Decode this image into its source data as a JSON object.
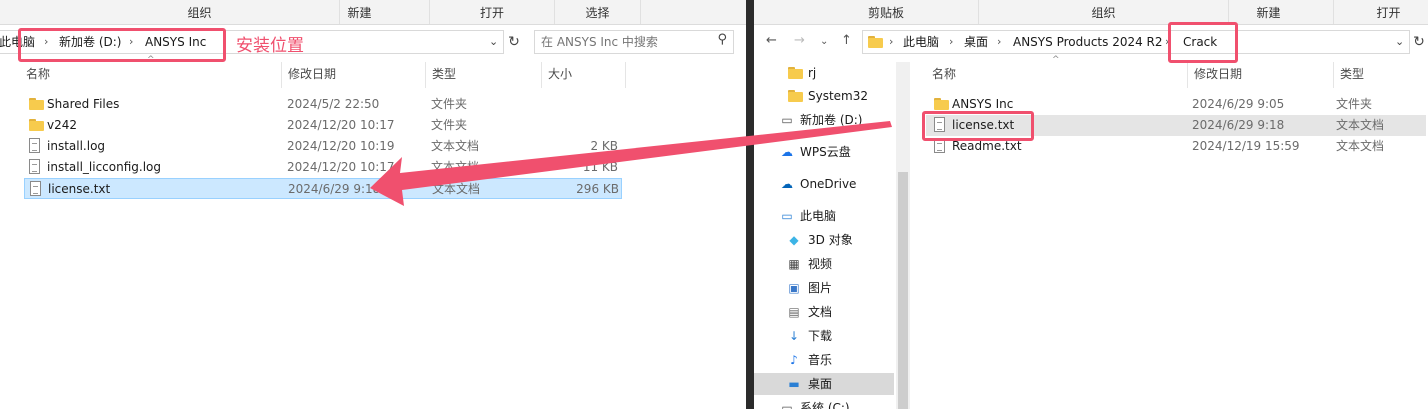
{
  "left": {
    "ribbon": [
      "组织",
      "新建",
      "打开",
      "选择"
    ],
    "breadcrumb": [
      "此电脑",
      "新加卷 (D:)",
      "ANSYS Inc"
    ],
    "search_placeholder": "在 ANSYS Inc 中搜索",
    "columns": [
      "名称",
      "修改日期",
      "类型",
      "大小"
    ],
    "files": [
      {
        "name": "Shared Files",
        "date": "2024/5/2 22:50",
        "type": "文件夹",
        "size": "",
        "icon": "folder-icon"
      },
      {
        "name": "v242",
        "date": "2024/12/20 10:17",
        "type": "文件夹",
        "size": "",
        "icon": "folder-icon"
      },
      {
        "name": "install.log",
        "date": "2024/12/20 10:19",
        "type": "文本文档",
        "size": "2 KB",
        "icon": "text-file-icon"
      },
      {
        "name": "install_licconfig.log",
        "date": "2024/12/20 10:17",
        "type": "文本文档",
        "size": "11 KB",
        "icon": "text-file-icon"
      },
      {
        "name": "license.txt",
        "date": "2024/6/29 9:18",
        "type": "文本文档",
        "size": "296 KB",
        "icon": "text-file-icon",
        "selected": true
      }
    ]
  },
  "annotation": {
    "install_location": "安装位置",
    "color": "#f0506e"
  },
  "right": {
    "ribbon": [
      "剪贴板",
      "组织",
      "新建",
      "打开"
    ],
    "breadcrumb": [
      "此电脑",
      "桌面",
      "ANSYS Products 2024 R2",
      "Crack"
    ],
    "columns": [
      "名称",
      "修改日期",
      "类型"
    ],
    "files": [
      {
        "name": "ANSYS Inc",
        "date": "2024/6/29 9:05",
        "type": "文件夹",
        "icon": "folder-icon"
      },
      {
        "name": "license.txt",
        "date": "2024/6/29 9:18",
        "type": "文本文档",
        "icon": "text-file-icon",
        "hover": true
      },
      {
        "name": "Readme.txt",
        "date": "2024/12/19 15:59",
        "type": "文本文档",
        "icon": "text-file-icon"
      }
    ],
    "tree": [
      {
        "label": "rj",
        "icon": "folder-icon"
      },
      {
        "label": "System32",
        "icon": "folder-icon"
      },
      {
        "label": "新加卷 (D:)",
        "icon": "drive-icon"
      },
      {
        "label": "WPS云盘",
        "icon": "cloud-icon"
      },
      {
        "label": "OneDrive",
        "icon": "onedrive-icon"
      },
      {
        "label": "此电脑",
        "icon": "computer-icon"
      },
      {
        "label": "3D 对象",
        "icon": "cube-icon"
      },
      {
        "label": "视频",
        "icon": "video-icon"
      },
      {
        "label": "图片",
        "icon": "picture-icon"
      },
      {
        "label": "文档",
        "icon": "document-icon"
      },
      {
        "label": "下载",
        "icon": "download-icon"
      },
      {
        "label": "音乐",
        "icon": "music-icon"
      },
      {
        "label": "桌面",
        "icon": "desktop-icon",
        "selected": true
      },
      {
        "label": "系统 (C:)",
        "icon": "drive-icon"
      }
    ]
  }
}
